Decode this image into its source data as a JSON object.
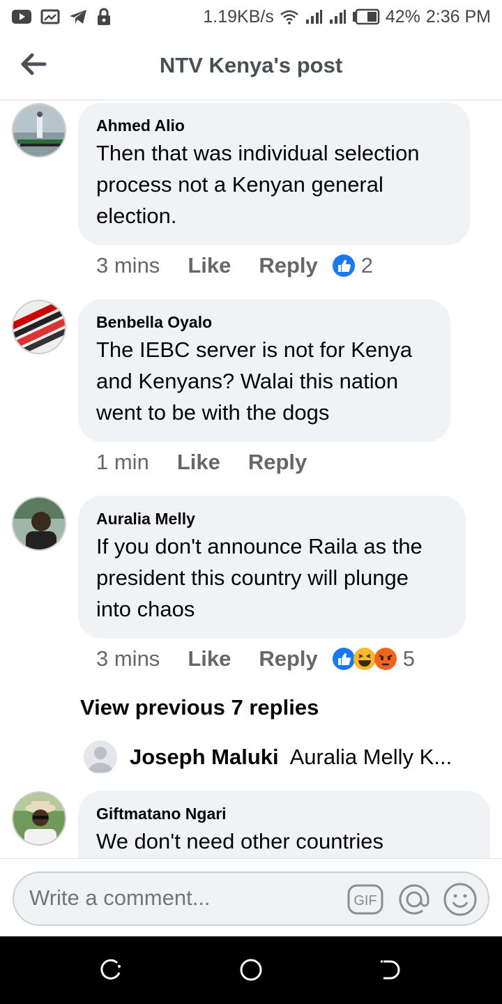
{
  "status_bar": {
    "speed": "1.19KB/s",
    "battery": "42%",
    "time": "2:36 PM"
  },
  "header": {
    "title": "NTV Kenya's post"
  },
  "comments": [
    {
      "name": "Ahmed Alio",
      "text": "Then that was individual selection process not a Kenyan general election.",
      "time": "3 mins",
      "like": "Like",
      "reply": "Reply",
      "reaction_count": "2",
      "reactions": [
        "like-icon"
      ]
    },
    {
      "name": "Benbella Oyalo",
      "text": "The IEBC server is not for Kenya and Kenyans? Walai this nation went to be with the dogs",
      "time": "1 min",
      "like": "Like",
      "reply": "Reply",
      "reaction_count": "",
      "reactions": []
    },
    {
      "name": "Auralia Melly",
      "text": "If you don't announce Raila as the president this country will plunge into chaos",
      "time": "3 mins",
      "like": "Like",
      "reply": "Reply",
      "reaction_count": "5",
      "reactions": [
        "like-icon",
        "haha-icon",
        "angry-icon"
      ]
    },
    {
      "name": "Giftmatano Ngari",
      "text": "We don't need other countries"
    }
  ],
  "thread": {
    "view_previous": "View previous 7 replies",
    "reply_name": "Joseph Maluki",
    "reply_preview": "Auralia Melly K..."
  },
  "composer": {
    "placeholder": "Write a comment...",
    "gif_label": "GIF"
  },
  "colors": {
    "bubble": "#f0f2f5",
    "like_blue": "#1877f2",
    "meta_gray": "#65676b",
    "angry": "#f0641e",
    "haha": "#f7b928"
  }
}
